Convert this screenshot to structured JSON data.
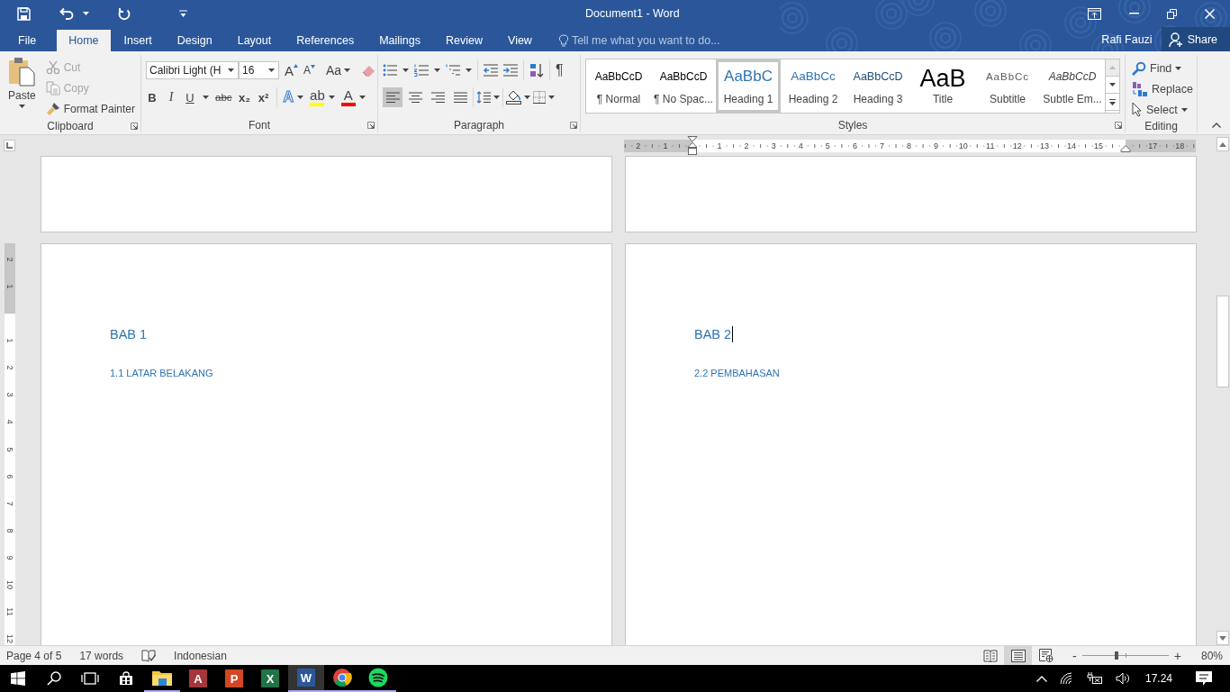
{
  "window": {
    "title": "Document1 - Word"
  },
  "tabs": [
    {
      "label": "File",
      "selected": false
    },
    {
      "label": "Home",
      "selected": true
    },
    {
      "label": "Insert",
      "selected": false
    },
    {
      "label": "Design",
      "selected": false
    },
    {
      "label": "Layout",
      "selected": false
    },
    {
      "label": "References",
      "selected": false
    },
    {
      "label": "Mailings",
      "selected": false
    },
    {
      "label": "Review",
      "selected": false
    },
    {
      "label": "View",
      "selected": false
    }
  ],
  "tell_me": {
    "placeholder": "Tell me what you want to do..."
  },
  "account": {
    "user": "Rafi Fauzi",
    "share": "Share"
  },
  "ribbon": {
    "clipboard": {
      "label": "Clipboard",
      "paste": "Paste",
      "items": [
        {
          "label": "Cut",
          "kind": "cut",
          "disabled": true
        },
        {
          "label": "Copy",
          "kind": "copy",
          "disabled": true
        },
        {
          "label": "Format Painter",
          "kind": "format-painter",
          "disabled": false
        }
      ]
    },
    "font": {
      "label": "Font",
      "font_name": "Calibri Light (H",
      "font_size": "16",
      "grow": "A",
      "shrink": "A",
      "change_case": "Aa",
      "format_buttons": [
        {
          "glyph": "B",
          "kind": "bold"
        },
        {
          "glyph": "I",
          "kind": "italic"
        },
        {
          "glyph": "U",
          "kind": "underline"
        },
        {
          "glyph": "abc",
          "kind": "strikethrough"
        },
        {
          "glyph": "x₂",
          "kind": "subscript"
        },
        {
          "glyph": "x²",
          "kind": "superscript"
        }
      ],
      "effects": [
        {
          "glyph": "A",
          "kind": "text-effects"
        },
        {
          "glyph": "ab",
          "kind": "highlight",
          "color": "#ffff00"
        },
        {
          "glyph": "A",
          "kind": "font-color",
          "color": "#ff0000"
        }
      ]
    },
    "paragraph": {
      "label": "Paragraph",
      "pilcrow": "¶",
      "alignment": [
        {
          "kind": "left",
          "selected": true
        },
        {
          "kind": "center",
          "selected": false
        },
        {
          "kind": "right",
          "selected": false
        },
        {
          "kind": "justify",
          "selected": false
        }
      ]
    },
    "styles": {
      "label": "Styles",
      "items": [
        {
          "preview": "AaBbCcD",
          "label": "¶ Normal",
          "kind": "normal",
          "selected": false
        },
        {
          "preview": "AaBbCcD",
          "label": "¶ No Spac...",
          "kind": "no-spacing",
          "selected": false
        },
        {
          "preview": "AaBbC",
          "label": "Heading 1",
          "kind": "heading1",
          "selected": true
        },
        {
          "preview": "AaBbCc",
          "label": "Heading 2",
          "kind": "heading2",
          "selected": false
        },
        {
          "preview": "AaBbCcD",
          "label": "Heading 3",
          "kind": "heading3",
          "selected": false
        },
        {
          "preview": "AaB",
          "label": "Title",
          "kind": "title",
          "selected": false
        },
        {
          "preview": "AaBbCc",
          "label": "Subtitle",
          "kind": "subtitle",
          "selected": false
        },
        {
          "preview": "AaBbCcD",
          "label": "Subtle Em...",
          "kind": "subtle",
          "selected": false
        }
      ]
    },
    "editing": {
      "label": "Editing",
      "items": [
        {
          "label": "Find",
          "kind": "find"
        },
        {
          "label": "Replace",
          "kind": "replace"
        },
        {
          "label": "Select",
          "kind": "select"
        }
      ]
    }
  },
  "ruler": {
    "horizontal": [
      "2",
      "1",
      "1",
      "2",
      "3",
      "4",
      "5",
      "6",
      "7",
      "8",
      "9",
      "10",
      "11",
      "12",
      "13",
      "14",
      "15",
      "17",
      "18"
    ],
    "vertical": [
      "2",
      "1",
      "1",
      "2",
      "3",
      "4",
      "5",
      "6",
      "7",
      "8",
      "9",
      "10",
      "11",
      "12"
    ]
  },
  "pages": [
    {
      "heading": "BAB 1",
      "subheading": "1.1 LATAR BELAKANG",
      "cursor": false
    },
    {
      "heading": "BAB 2",
      "subheading": "2.2 PEMBAHASAN",
      "cursor": true
    }
  ],
  "status_bar": {
    "page": "Page 4 of 5",
    "words": "17 words",
    "language": "Indonesian",
    "views": [
      {
        "kind": "read",
        "selected": false
      },
      {
        "kind": "print",
        "selected": true
      },
      {
        "kind": "web",
        "selected": false
      }
    ],
    "zoom": {
      "minus": "-",
      "plus": "+",
      "level": 0.4,
      "reading": "80%"
    }
  },
  "taskbar": {
    "apps": [
      {
        "kind": "explorer",
        "running": true,
        "selected": false
      },
      {
        "kind": "access",
        "glyph": "A",
        "running": false,
        "selected": false
      },
      {
        "kind": "powerpoint",
        "glyph": "P",
        "running": false,
        "selected": false
      },
      {
        "kind": "excel",
        "glyph": "X",
        "running": false,
        "selected": false
      },
      {
        "kind": "word",
        "glyph": "W",
        "running": true,
        "selected": true
      },
      {
        "kind": "chrome",
        "running": true,
        "selected": false
      },
      {
        "kind": "spotify",
        "running": true,
        "selected": false
      }
    ],
    "clock": "17.24"
  }
}
